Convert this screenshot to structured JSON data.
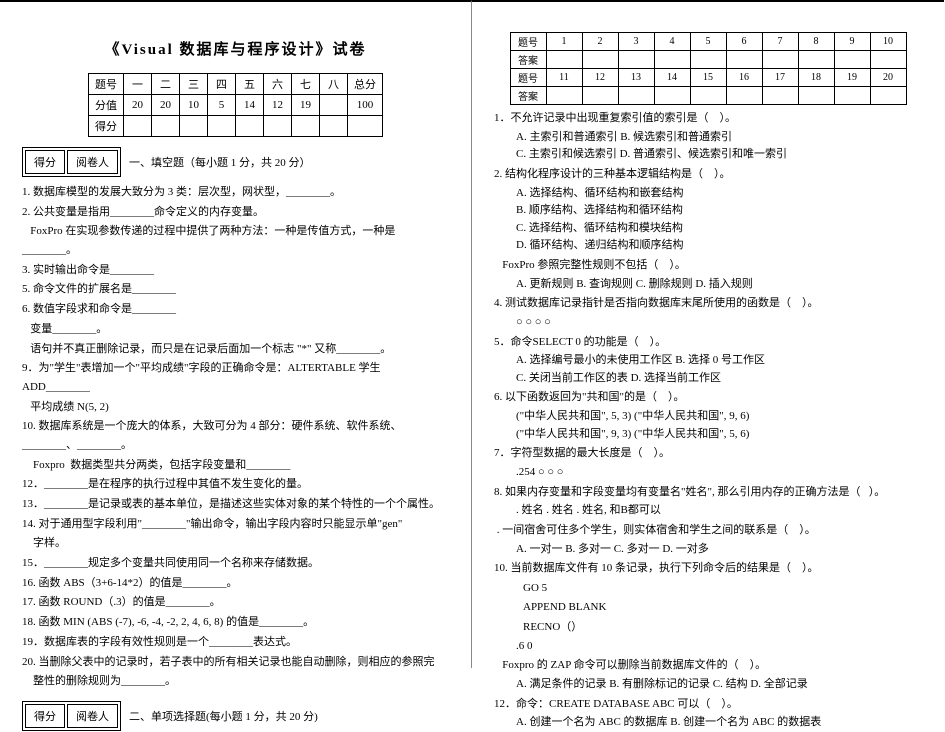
{
  "title": "《Visual 数据库与程序设计》试卷",
  "scoreTable": {
    "headerRow": [
      "题号",
      "一",
      "二",
      "三",
      "四",
      "五",
      "六",
      "七",
      "八",
      "总分"
    ],
    "pointsRow": [
      "分值",
      "20",
      "20",
      "10",
      "5",
      "14",
      "12",
      "19",
      "",
      "100"
    ],
    "gotRow": [
      "得分",
      "",
      "",
      "",
      "",
      "",
      "",
      "",
      "",
      ""
    ]
  },
  "scorerBox": {
    "left": "得分",
    "right": "阅卷人"
  },
  "section1": "一、填空题（每小题 1 分，共 20 分）",
  "q1_1": "1. 数据库模型的发展大致分为 3 类：层次型，网状型，________。",
  "q1_2a": "2. 公共变量是指用________命令定义的内存变量。",
  "q1_2b": "   FoxPro 在实现参数传递的过程中提供了两种方法：一种是传值方式，一种是________。",
  "q1_3": "3. 实时输出命令是________",
  "q1_4": "5. 命令文件的扩展名是________",
  "q1_5": "6. 数值字段求和命令是________",
  "q1_6": "   变量________。",
  "q1_7": "   语句并不真正删除记录，而只是在记录后面加一个标志 \"*\" 又称________。",
  "q1_9": "9．为\"学生\"表增加一个\"平均成绩\"字段的正确命令是：ALTERTABLE 学生 ADD________",
  "q1_9b": "   平均成绩 N(5, 2)",
  "q1_10": "10. 数据库系统是一个庞大的体系，大致可分为 4 部分：硬件系统、软件系统、________、________。",
  "q1_11": "    Foxpro  数据类型共分两类，包括字段变量和________",
  "q1_12": "12．________是在程序的执行过程中其值不发生变化的量。",
  "q1_13": "13．________是记录或表的基本单位，是描述这些实体对象的某个特性的一个个属性。",
  "q1_14": "14. 对于通用型字段利用\"________\"输出命令，输出字段内容时只能显示单\"gen\"",
  "q1_14b": "    字样。",
  "q1_15": "15．________规定多个变量共同使用同一个名称来存储数据。",
  "q1_16": "16. 函数 ABS（3+6-14*2）的值是________。",
  "q1_17": "17. 函数 ROUND（.3）的值是________。",
  "q1_18": "18. 函数 MIN (ABS (-7), -6, -4, -2, 2, 4, 6, 8) 的值是________。",
  "q1_19": "19．数据库表的字段有效性规则是一个________表达式。",
  "q1_20": "20. 当删除父表中的记录时，若子表中的所有相关记录也能自动删除，则相应的参照完",
  "q1_20b": "    整性的删除规则为________。",
  "section2": "二、单项选择题(每小题 1 分，共 20 分)",
  "ansHead1": [
    "题号",
    "1",
    "2",
    "3",
    "4",
    "5",
    "6",
    "7",
    "8",
    "9",
    "10"
  ],
  "ansBlank": [
    "答案",
    "",
    "",
    "",
    "",
    "",
    "",
    "",
    "",
    "",
    ""
  ],
  "ansHead2": [
    "题号",
    "11",
    "12",
    "13",
    "14",
    "15",
    "16",
    "17",
    "18",
    "19",
    "20"
  ],
  "r1": "1．不允许记录中出现重复索引值的索引是（    ）。",
  "r1a": "A. 主索引和普通索引                B. 候选索引和普通索引",
  "r1b": "C. 主索引和候选索引                D. 普通索引、候选索引和唯一索引",
  "r2": "2. 结构化程序设计的三种基本逻辑结构是（    ）。",
  "r2a": "A. 选择结构、循环结构和嵌套结构",
  "r2b": "B. 顺序结构、选择结构和循环结构",
  "r2c": "C. 选择结构、循环结构和模块结构",
  "r2d": "D. 循环结构、递归结构和顺序结构",
  "r3": "   FoxPro 参照完整性规则不包括（    ）。",
  "r3a": "A. 更新规则     B. 查询规则     C. 删除规则     D. 插入规则",
  "r4": "4. 测试数据库记录指针是否指向数据库末尾所使用的函数是（    ）。",
  "r4a": "     ○         ○         ○         ○",
  "r5": "5．命令SELECT 0 的功能是（    ）。",
  "r5a": "A. 选择编号最小的未使用工作区             B. 选择 0 号工作区",
  "r5b": "C. 关闭当前工作区的表                     D. 选择当前工作区",
  "r6": "6. 以下函数返回为\"共和国\"的是（    ）。",
  "r6a": "(\"中华人民共和国\",  5,  3)        (\"中华人民共和国\", 9, 6)",
  "r6b": "(\"中华人民共和国\",  9,  3)        (\"中华人民共和国\", 5, 6)",
  "r7": "7．字符型数据的最大长度是（    ）。",
  "r7a": "     .254       ○         ○         ○",
  "r8": "8. 如果内存变量和字段变量均有变量名\"姓名\", 那么引用内存的正确方法是（   ）。",
  "r8a": ". 姓名      . 姓名      . 姓名, 和B都可以",
  "r9": " . 一间宿舍可住多个学生，则实体宿舍和学生之间的联系是（    ）。",
  "r9a": "A. 一对一     B. 多对一     C. 多对一     D. 一对多",
  "r10": "10. 当前数据库文件有 10 条记录，执行下列命令后的结果是（    ）。",
  "r10a": "    GO 5",
  "r10b": "    APPEND BLANK",
  "r10c": "    RECNO（）",
  "r10d": "         .6                 0",
  "r11": "   Foxpro 的 ZAP 命令可以删除当前数据库文件的（    ）。",
  "r11a": "A. 满足条件的记录    B. 有删除标记的记录    C. 结构    D. 全部记录",
  "r12": "12．命令：CREATE DATABASE ABC 可以（    ）。",
  "r12a": "A. 创建一个名为 ABC 的数据库        B. 创建一个名为 ABC 的数据表"
}
